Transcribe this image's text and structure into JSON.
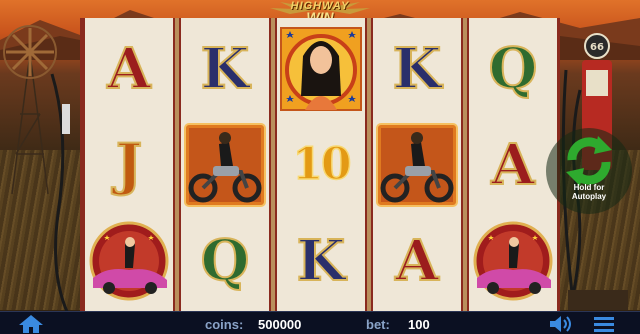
{
  "game": {
    "logo": {
      "line1": "HIGHWAY",
      "line2": "WIN"
    }
  },
  "reels": [
    {
      "symbols": [
        {
          "type": "letter",
          "value": "A",
          "color": "#9b1d1d"
        },
        {
          "type": "letter",
          "value": "J",
          "color": "#c05a10"
        },
        {
          "type": "image",
          "icon": "pinup-car-symbol"
        }
      ]
    },
    {
      "symbols": [
        {
          "type": "letter",
          "value": "K",
          "color": "#2a2f6b"
        },
        {
          "type": "image",
          "icon": "biker-symbol"
        },
        {
          "type": "letter",
          "value": "Q",
          "color": "#2f6b2f"
        }
      ]
    },
    {
      "symbols": [
        {
          "type": "image",
          "icon": "woman-portrait-symbol"
        },
        {
          "type": "number",
          "value": "10",
          "color": "#e39a14"
        },
        {
          "type": "letter",
          "value": "K",
          "color": "#2a2f6b"
        }
      ]
    },
    {
      "symbols": [
        {
          "type": "letter",
          "value": "K",
          "color": "#2a2f6b"
        },
        {
          "type": "image",
          "icon": "biker-symbol"
        },
        {
          "type": "letter",
          "value": "A",
          "color": "#9b1d1d"
        }
      ]
    },
    {
      "symbols": [
        {
          "type": "letter",
          "value": "Q",
          "color": "#2f6b2f"
        },
        {
          "type": "letter",
          "value": "A",
          "color": "#9b1d1d"
        },
        {
          "type": "image",
          "icon": "pinup-car-symbol"
        }
      ]
    }
  ],
  "autoplay": {
    "line1": "Hold for",
    "line2": "Autoplay",
    "icon": "refresh-arrows-icon"
  },
  "bottom_bar": {
    "home_icon": "home-icon",
    "coins_label": "coins:",
    "coins_value": "500000",
    "bet_label": "bet:",
    "bet_value": "100",
    "sound_icon": "speaker-icon",
    "menu_icon": "menu-icon"
  },
  "colors": {
    "frame": "#8a2a1e",
    "reel_bg": "#efe7d7",
    "bar_bg": "#0b1022",
    "autoplay_green": "#2eaa2e"
  }
}
